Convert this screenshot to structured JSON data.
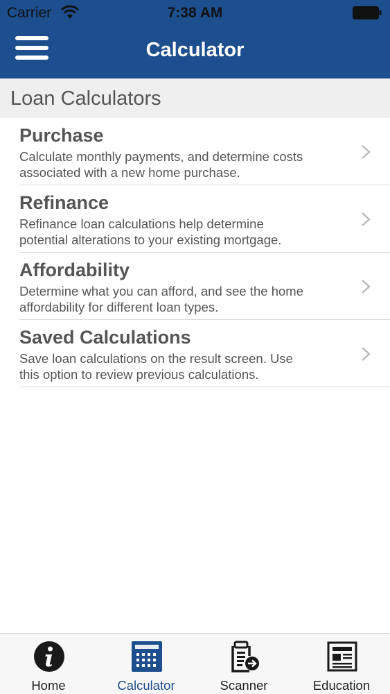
{
  "status": {
    "carrier": "Carrier",
    "time": "7:38 AM"
  },
  "nav": {
    "title": "Calculator",
    "menu_icon": "hamburger-menu-icon"
  },
  "section": {
    "title": "Loan Calculators"
  },
  "items": [
    {
      "title": "Purchase",
      "line1": "Calculate monthly payments, and determine costs",
      "line2": "associated with a new home purchase."
    },
    {
      "title": "Refinance",
      "line1": "Refinance loan calculations help determine",
      "line2": "potential alterations to your existing mortgage."
    },
    {
      "title": "Affordability",
      "line1": "Determine what you can afford, and see the home",
      "line2": "affordability for different loan types."
    },
    {
      "title": "Saved Calculations",
      "line1": "Save loan calculations on the result screen. Use",
      "line2": "this option to review previous calculations."
    }
  ],
  "tabs": [
    {
      "label": "Home",
      "icon": "info-icon",
      "active": false
    },
    {
      "label": "Calculator",
      "icon": "calculator-icon",
      "active": true
    },
    {
      "label": "Scanner",
      "icon": "scanner-icon",
      "active": false
    },
    {
      "label": "Education",
      "icon": "newspaper-icon",
      "active": false
    }
  ],
  "colors": {
    "brand": "#1d4f8e",
    "section_bg": "#efefef",
    "text": "#555555"
  }
}
